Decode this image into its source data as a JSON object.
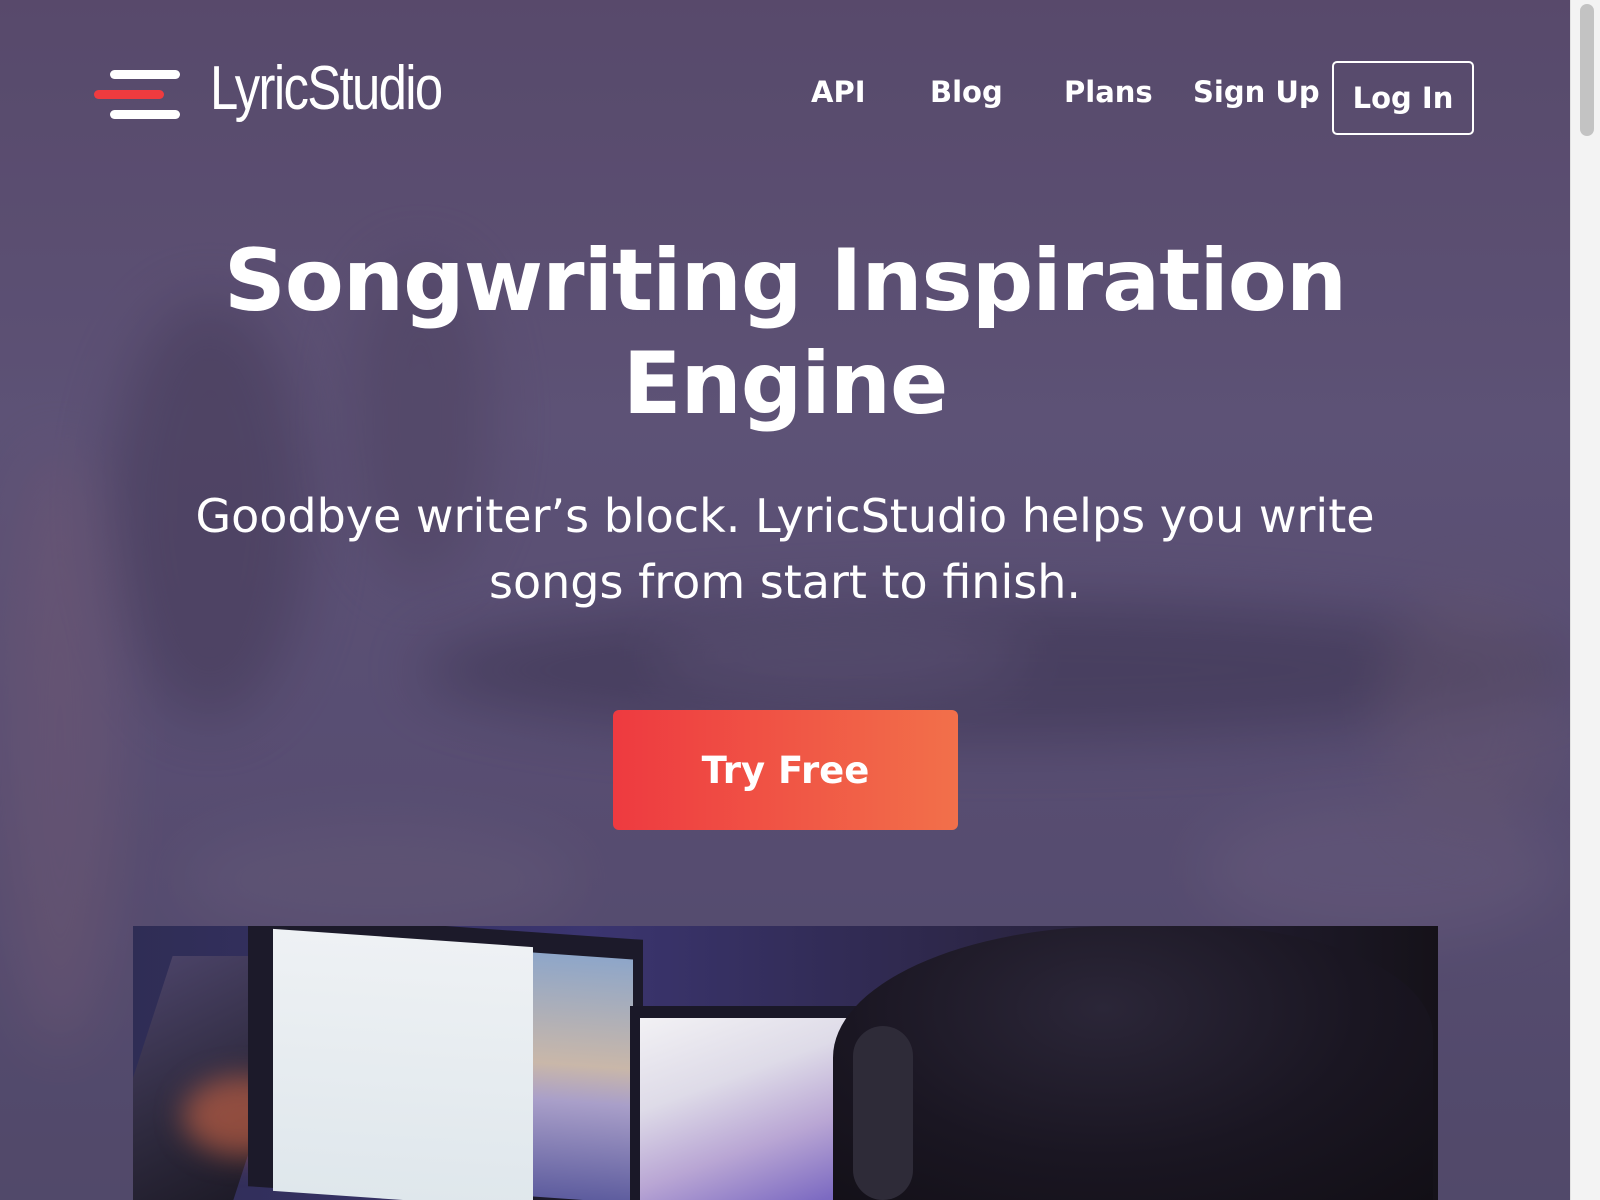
{
  "brand": {
    "name": "LyricStudio",
    "accent_color": "#ef3b3f",
    "logo_icon": "menu-lines-icon"
  },
  "nav": {
    "links": [
      {
        "label": "API"
      },
      {
        "label": "Blog"
      },
      {
        "label": "Plans"
      },
      {
        "label": "Sign Up"
      }
    ],
    "login_label": "Log In"
  },
  "hero": {
    "title": "Songwriting Inspiration Engine",
    "subtitle": "Goodbye writer’s block. LyricStudio helps you write songs from start to finish.",
    "cta_label": "Try Free",
    "cta_gradient": [
      "#ee3a40",
      "#f2704a"
    ]
  },
  "preview": {
    "icon": "studio-photo"
  }
}
